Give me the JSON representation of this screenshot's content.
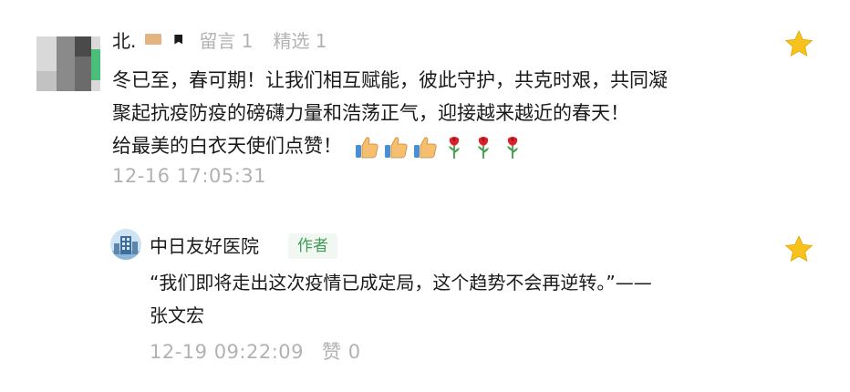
{
  "comment": {
    "nickname": "北.",
    "stats": {
      "messages_label": "留言 1",
      "featured_label": "精选 1"
    },
    "lines": [
      "冬已至，春可期！让我们相互赋能，彼此守护，共克时艰，共同凝",
      "聚起抗疫防疫的磅礴力量和浩荡正气，迎接越来越近的春天！",
      "给最美的白衣天使们点赞！"
    ],
    "emojis": [
      "thumbs-up-icon",
      "thumbs-up-icon",
      "thumbs-up-icon",
      "rose-icon",
      "rose-icon",
      "rose-icon"
    ],
    "timestamp": "12-16 17:05:31",
    "star_icon": "star-icon"
  },
  "reply": {
    "author_name": "中日友好医院",
    "author_tag": "作者",
    "lines": [
      "“我们即将走出这次疫情已成定局，这个趋势不会再逆转。”——",
      "张文宏"
    ],
    "timestamp": "12-19 09:22:09",
    "likes_label": "赞 0",
    "star_icon": "star-icon"
  },
  "colors": {
    "star": "#f7c21e",
    "muted_text": "#b2b2b2",
    "author_tag_text": "#3f9b55",
    "author_tag_bg": "#f1f7f1"
  }
}
